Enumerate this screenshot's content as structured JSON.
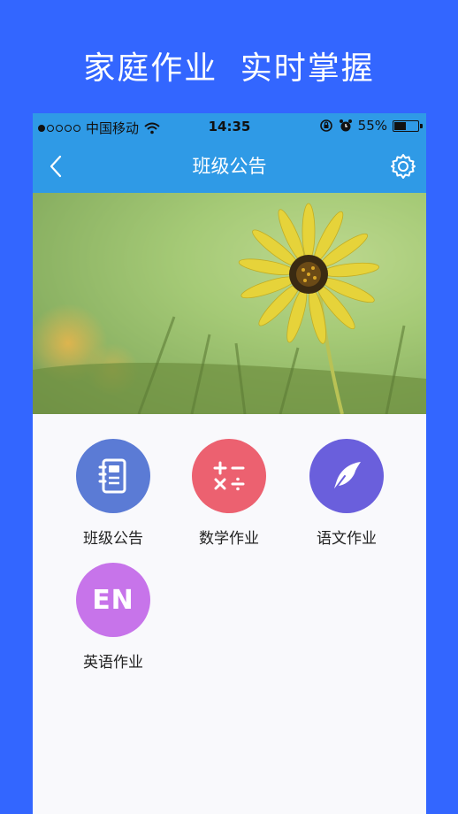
{
  "headline": "家庭作业  实时掌握",
  "status": {
    "carrier": "中国移动",
    "time": "14:35",
    "battery": "55%",
    "battery_level": 0.55
  },
  "nav": {
    "title": "班级公告"
  },
  "tiles": [
    {
      "label": "班级公告",
      "icon": "notebook-icon",
      "color": "#5b7bd5"
    },
    {
      "label": "数学作业",
      "icon": "math-symbols-icon",
      "color": "#ec6170"
    },
    {
      "label": "语文作业",
      "icon": "feather-quill-icon",
      "color": "#6a5fdc"
    },
    {
      "label": "英语作业",
      "icon": "en-text-icon",
      "icon_text": "EN",
      "color": "#c774ea"
    }
  ]
}
